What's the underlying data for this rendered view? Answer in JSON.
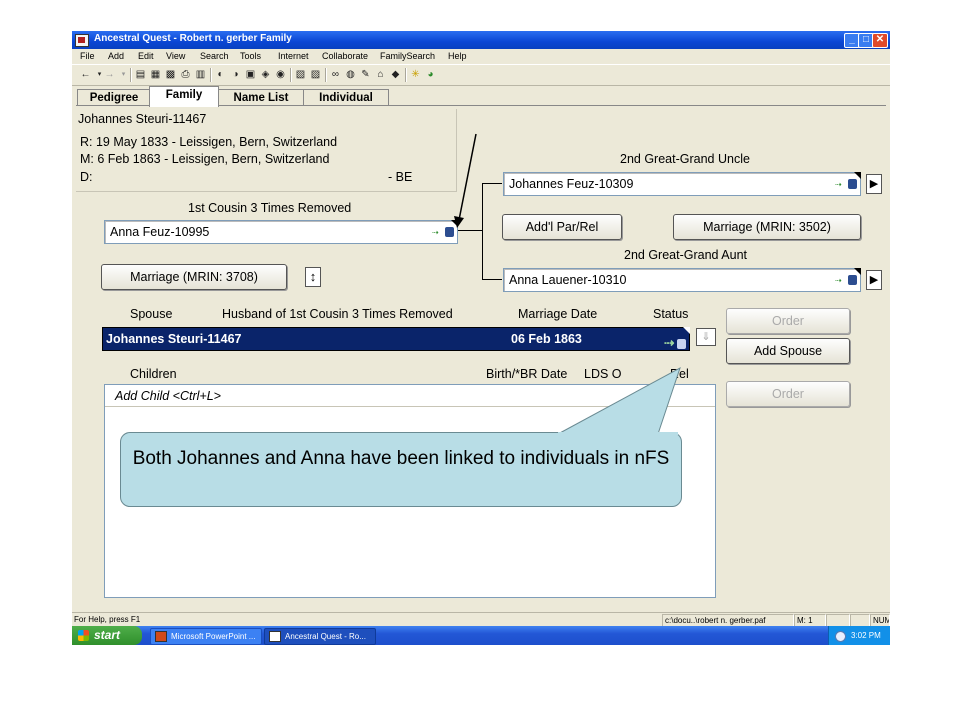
{
  "window": {
    "title": "Ancestral Quest - Robert n. gerber Family"
  },
  "menu": [
    "File",
    "Add",
    "Edit",
    "View",
    "Search",
    "Tools",
    "Internet",
    "Collaborate",
    "FamilySearch",
    "Help"
  ],
  "tabs": [
    {
      "label": "Pedigree",
      "active": false
    },
    {
      "label": "Family",
      "active": true
    },
    {
      "label": "Name List",
      "active": false
    },
    {
      "label": "Individual",
      "active": false
    }
  ],
  "info": {
    "name": "Johannes Steuri-11467",
    "r": "R: 19 May 1833 - Leissigen, Bern, Switzerland",
    "m": "M: 6 Feb 1863 - Leissigen, Bern, Switzerland",
    "d": "D:",
    "d_right": "- BE"
  },
  "cousin": {
    "label": "1st Cousin 3 Times Removed",
    "name": "Anna Feuz-10995"
  },
  "marriage_left": "Marriage (MRIN: 3708)",
  "uncle": {
    "label": "2nd Great-Grand Uncle",
    "name": "Johannes Feuz-10309"
  },
  "aunt": {
    "label": "2nd Great-Grand Aunt",
    "name": "Anna Lauener-10310"
  },
  "buttons": {
    "add_par_rel": "Add'l Par/Rel",
    "marriage_right": "Marriage (MRIN: 3502)",
    "order1": "Order",
    "add_spouse": "Add Spouse",
    "order2": "Order"
  },
  "spouse_headers": {
    "spouse": "Spouse",
    "husband": "Husband of 1st Cousin 3 Times Removed",
    "marriage_date": "Marriage Date",
    "status": "Status"
  },
  "spouse_row": {
    "name": "Johannes Steuri-11467",
    "date": "06  Feb  1863"
  },
  "children_headers": {
    "children": "Children",
    "birth": "Birth/*BR Date",
    "lds": "LDS O",
    "rel": "Rel"
  },
  "children": {
    "add_child": "Add Child <Ctrl+L>"
  },
  "callout": "Both Johannes and Anna have been linked to individuals in nFS",
  "statusbar": {
    "help": "For Help, press F1",
    "path": "c:\\docu..\\robert n. gerber.paf",
    "m": "M: 1",
    "num": "NUM"
  },
  "taskbar": {
    "start": "start",
    "tasks": [
      "Microsoft PowerPoint ...",
      "Ancestral Quest - Ro..."
    ],
    "clock": "3:02 PM"
  },
  "colors": {
    "titlebar": "#0a46d4",
    "selection": "#0a246a",
    "callout": "#b8dde6",
    "taskbar": "#2357d6",
    "start": "#2f8f2b"
  }
}
